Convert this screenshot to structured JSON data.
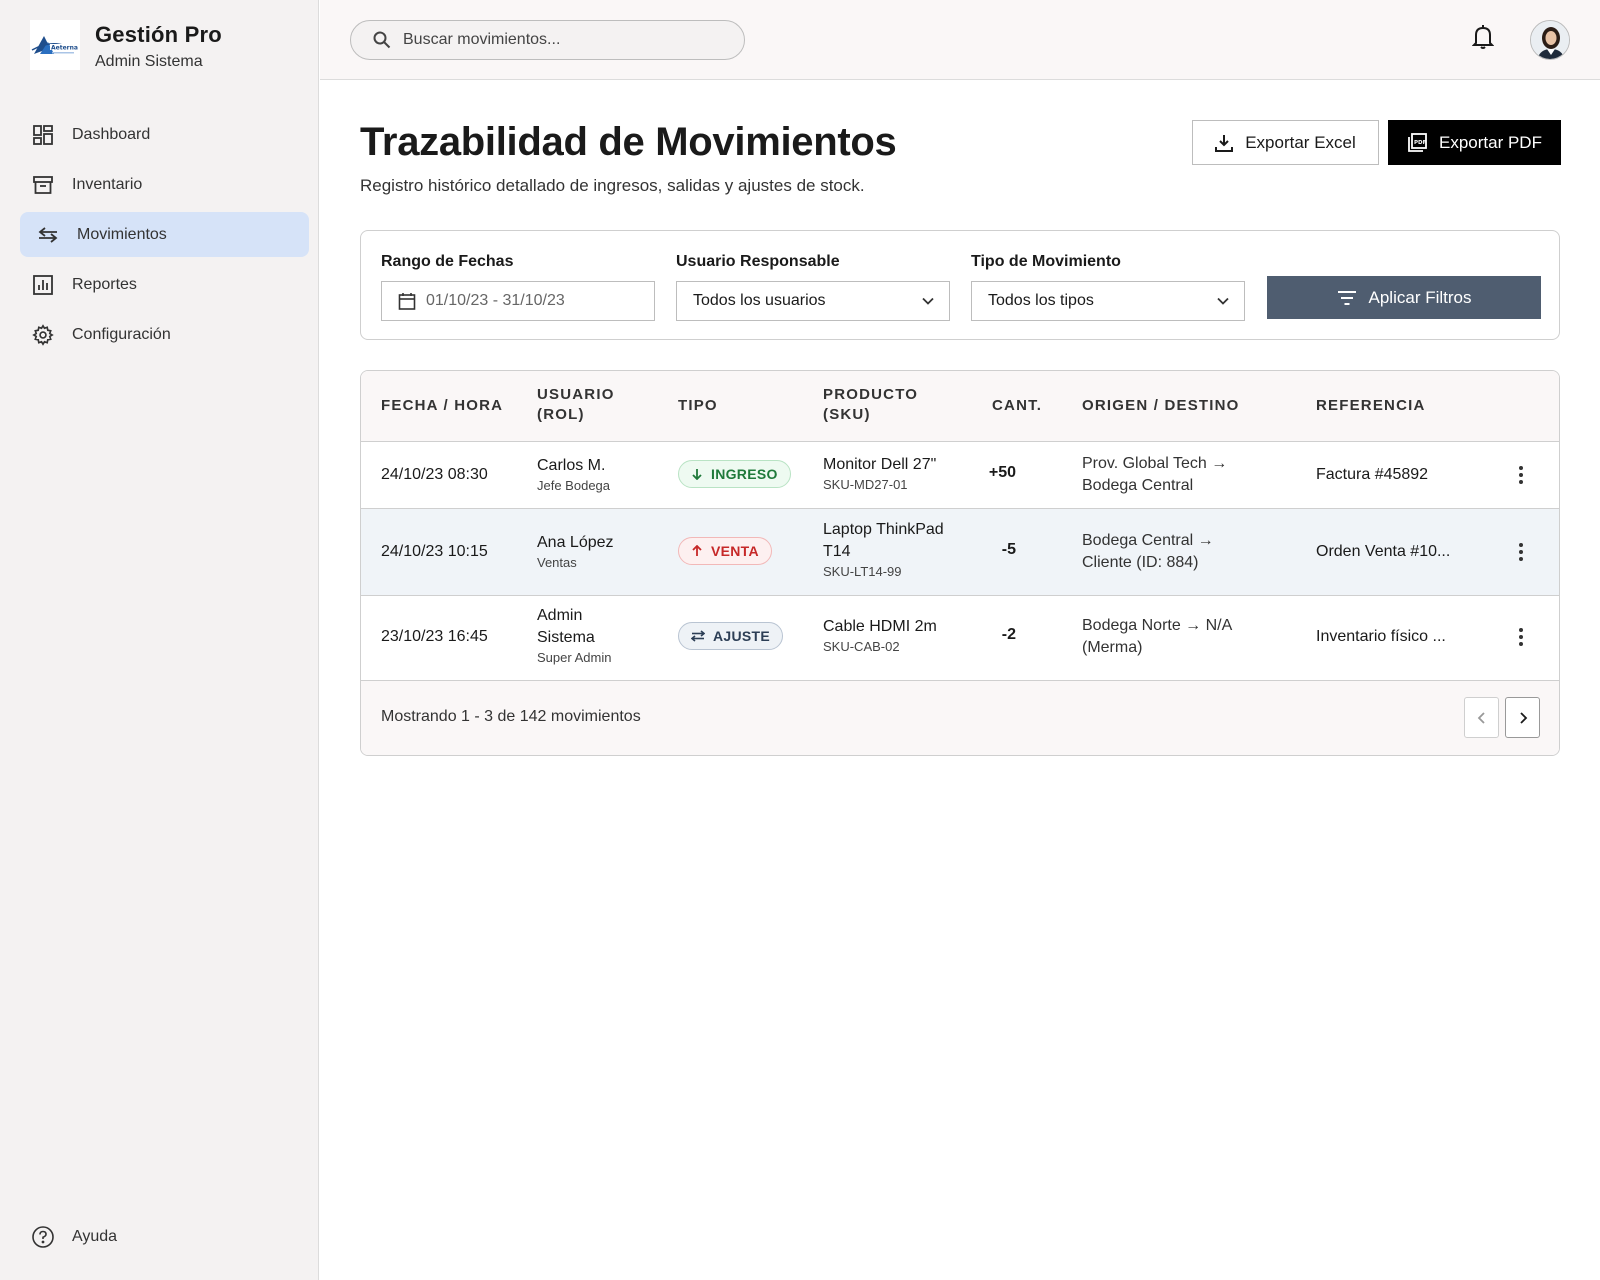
{
  "brand": {
    "title": "Gestión Pro",
    "subtitle": "Admin Sistema"
  },
  "sidebar": {
    "items": [
      {
        "label": "Dashboard",
        "icon": "dashboard-icon"
      },
      {
        "label": "Inventario",
        "icon": "archive-icon"
      },
      {
        "label": "Movimientos",
        "icon": "swap-arrows-icon",
        "active": true
      },
      {
        "label": "Reportes",
        "icon": "bar-chart-icon"
      },
      {
        "label": "Configuración",
        "icon": "gear-icon"
      }
    ],
    "help": "Ayuda"
  },
  "topbar": {
    "search_placeholder": "Buscar movimientos..."
  },
  "page": {
    "title": "Trazabilidad de Movimientos",
    "subtitle": "Registro histórico detallado de ingresos, salidas y ajustes de stock.",
    "export_excel": "Exportar Excel",
    "export_pdf": "Exportar PDF"
  },
  "filters": {
    "date_label": "Rango de Fechas",
    "date_value": "01/10/23 - 31/10/23",
    "user_label": "Usuario Responsable",
    "user_value": "Todos los usuarios",
    "type_label": "Tipo de Movimiento",
    "type_value": "Todos los tipos",
    "apply": "Aplicar Filtros"
  },
  "table": {
    "headers": {
      "fecha_hora": "FECHA / HORA",
      "usuario_1": "USUARIO",
      "usuario_2": "(ROL)",
      "tipo": "TIPO",
      "producto_1": "PRODUCTO",
      "producto_2": "(SKU)",
      "cant": "CANT.",
      "origen": "ORIGEN / DESTINO",
      "referencia": "REFERENCIA"
    },
    "rows": [
      {
        "fecha": "24/10/23 08:30",
        "usuario": "Carlos M.",
        "rol": "Jefe Bodega",
        "tipo": "INGRESO",
        "producto": "Monitor Dell 27\"",
        "sku": "SKU-MD27-01",
        "cant": "+50",
        "origen_1": "Prov. Global Tech →",
        "origen_2": "Bodega Central",
        "referencia": "Factura #45892"
      },
      {
        "fecha": "24/10/23 10:15",
        "usuario": "Ana López",
        "rol": "Ventas",
        "tipo": "VENTA",
        "producto_1": "Laptop ThinkPad",
        "producto_2": "T14",
        "sku": "SKU-LT14-99",
        "cant": "-5",
        "origen_1": "Bodega Central →",
        "origen_2": "Cliente (ID: 884)",
        "referencia": "Orden Venta #10..."
      },
      {
        "fecha": "23/10/23 16:45",
        "usuario_1": "Admin",
        "usuario_2": "Sistema",
        "rol": "Super Admin",
        "tipo": "AJUSTE",
        "producto": "Cable HDMI 2m",
        "sku": "SKU-CAB-02",
        "cant": "-2",
        "origen_1": "Bodega Norte → N/A",
        "origen_2": "(Merma)",
        "referencia": "Inventario físico ..."
      }
    ],
    "footer": "Mostrando 1 - 3 de 142 movimientos"
  },
  "colors": {
    "active_nav": "#d6e3f8",
    "apply_button": "#4f5d70",
    "ingreso": "#1f7a3a",
    "venta": "#c62828",
    "ajuste": "#2c3e55"
  }
}
